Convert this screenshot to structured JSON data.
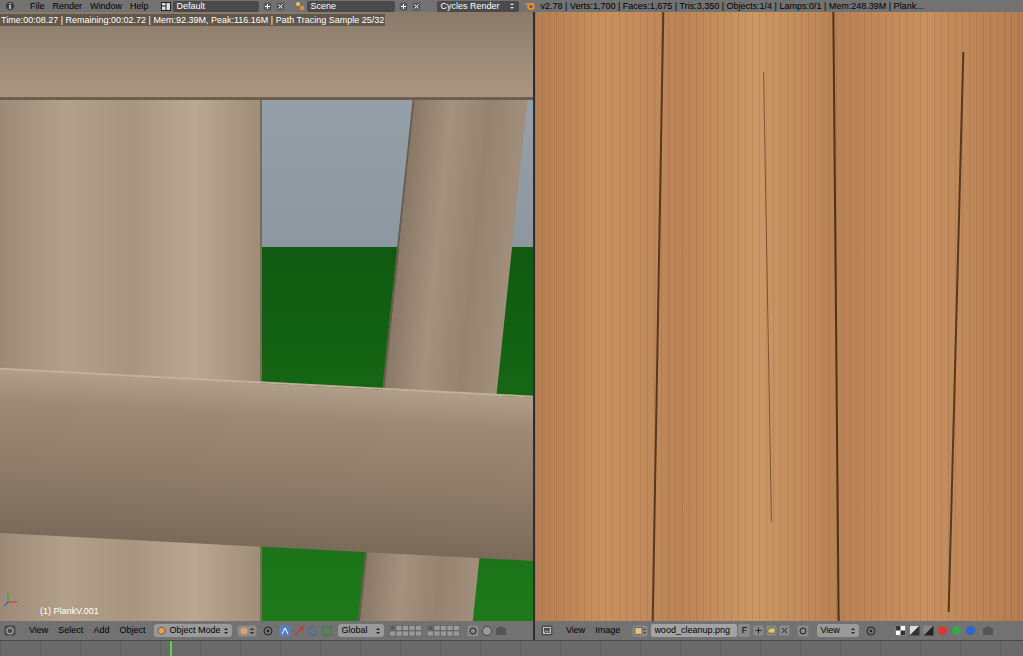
{
  "top_bar": {
    "menus": [
      "File",
      "Render",
      "Window",
      "Help"
    ],
    "screen_layout": "Default",
    "scene": "Scene",
    "render_engine": "Cycles Render",
    "stats": "v2.78 | Verts:1,700 | Faces:1,675 | Tris:3,350 | Objects:1/4 | Lamps:0/1 | Mem:248.39M | Plank..."
  },
  "viewport": {
    "render_info": "Time:00:08.27 | Remaining:00:02.72 | Mem:92.39M, Peak:116.16M | Path Tracing Sample 25/32",
    "object_label": "(1) PlankV.001",
    "header": {
      "menus": [
        "View",
        "Select",
        "Add",
        "Object"
      ],
      "mode": "Object Mode",
      "orientation": "Global"
    }
  },
  "image_editor": {
    "header": {
      "menus": [
        "View",
        "Image"
      ],
      "image_name": "wood_cleanup.png",
      "fake_user": "F",
      "view_menu": "View"
    }
  },
  "timeline": {
    "current_frame": {
      "level": 0.166
    }
  }
}
